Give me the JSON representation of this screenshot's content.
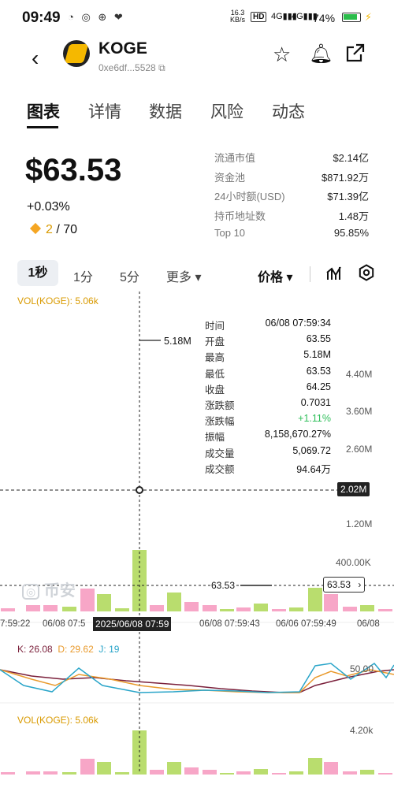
{
  "status_bar": {
    "time": "09:49",
    "net_speed_top": "16.3",
    "net_speed_bottom": "KB/s",
    "battery": "74%"
  },
  "token": {
    "name": "KOGE",
    "address": "0xe6df...5528"
  },
  "tabs": [
    "图表",
    "详情",
    "数据",
    "风险",
    "动态"
  ],
  "price": {
    "value": "$63.53",
    "change": "+0.03%",
    "rank_current": "2",
    "rank_total": "/ 70"
  },
  "stats": [
    {
      "label": "流通市值",
      "value": "$2.14亿"
    },
    {
      "label": "资金池",
      "value": "$871.92万"
    },
    {
      "label": "24小时额(USD)",
      "value": "$71.39亿"
    },
    {
      "label": "持币地址数",
      "value": "1.48万"
    },
    {
      "label": "Top 10",
      "value": "95.85%"
    }
  ],
  "intervals": {
    "active": "1秒",
    "items": [
      "1分",
      "5分",
      "更多 ▾"
    ],
    "price_type": "价格 ▾"
  },
  "chart": {
    "vol_label": "VOL(KOGE): 5.06k",
    "kdj_k": "K: 26.08",
    "kdj_d": "D: 29.62",
    "kdj_j": "J: 19",
    "y_labels": [
      "4.40M",
      "3.60M",
      "2.60M",
      "1.20M",
      "400.00K"
    ],
    "crosshair_value": "2.02M",
    "peak_label": "5.18M",
    "last_price_left": "63.53",
    "last_price_right": "63.53",
    "time_labels": [
      "7:59:22",
      "06/08 07:5",
      "06/08 07:59:43",
      "06/06 07:59:49",
      "06/08"
    ],
    "crosshair_time": "2025/06/08 07:59",
    "kdj_axis": "50.00",
    "vol_axis": "4.20k",
    "watermark": "币安"
  },
  "tooltip": [
    {
      "label": "时间",
      "value": "06/08 07:59:34"
    },
    {
      "label": "开盘",
      "value": "63.55"
    },
    {
      "label": "最高",
      "value": "5.18M"
    },
    {
      "label": "最低",
      "value": "63.53"
    },
    {
      "label": "收盘",
      "value": "64.25"
    },
    {
      "label": "涨跌额",
      "value": "0.7031"
    },
    {
      "label": "涨跌幅",
      "value": "+1.11%"
    },
    {
      "label": "振幅",
      "value": "8,158,670.27%"
    },
    {
      "label": "成交量",
      "value": "5,069.72"
    },
    {
      "label": "成交额",
      "value": "94.64万"
    }
  ],
  "colors": {
    "up": "#b9dd6e",
    "down": "#f7a6c7",
    "accent": "#f5b800"
  }
}
